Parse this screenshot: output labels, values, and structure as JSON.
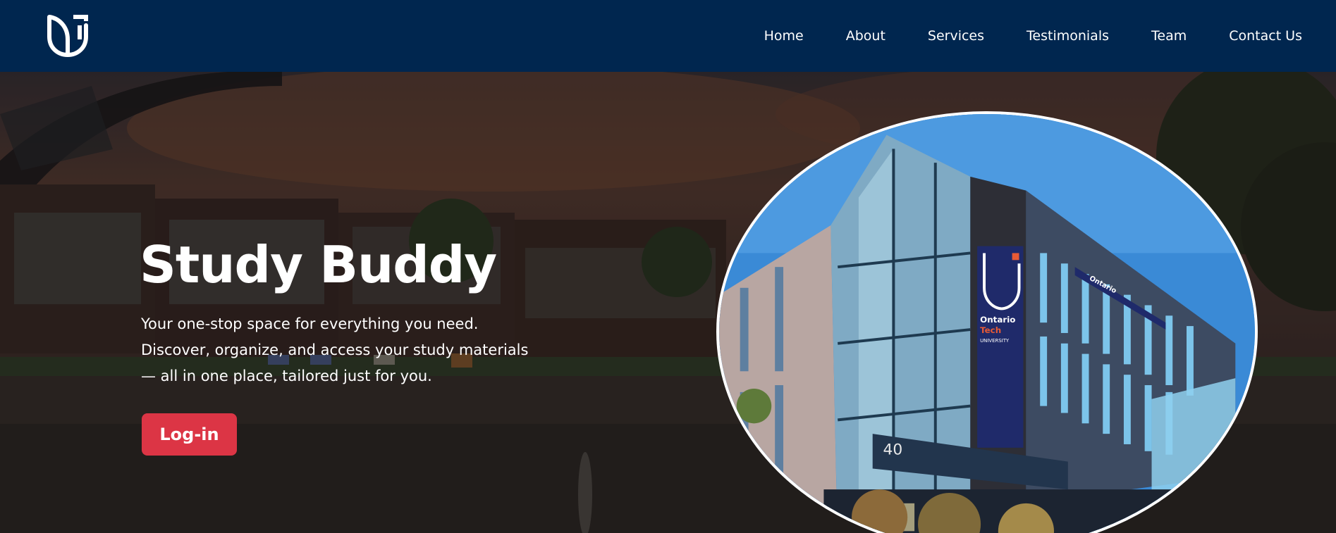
{
  "nav": {
    "logo_icon": "university-shield-icon",
    "links": [
      "Home",
      "About",
      "Services",
      "Testimonials",
      "Team",
      "Contact Us"
    ]
  },
  "hero": {
    "title": "Study Buddy",
    "description_lines": [
      "Your one-stop space for everything you need.",
      "Discover, organize, and access your study materials",
      "— all in one place, tailored just for you."
    ],
    "login_label": "Log-in",
    "building_number": "40",
    "banner_text": [
      "Ontario",
      "Tech",
      "UNIVERSITY"
    ],
    "roof_sign": "Ontario"
  },
  "colors": {
    "navbar": "#00264f",
    "login_button": "#dc3545",
    "text": "#ffffff"
  }
}
